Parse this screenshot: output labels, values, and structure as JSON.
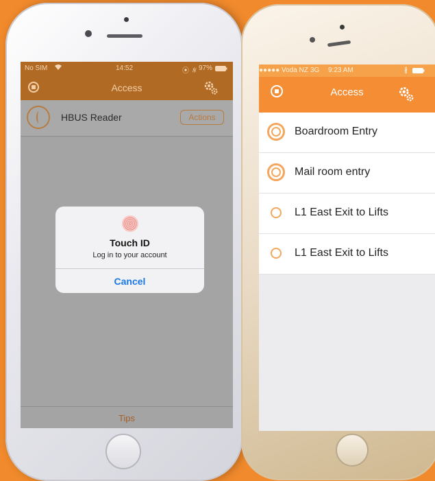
{
  "left_phone": {
    "status": {
      "carrier": "No SIM",
      "time": "14:52",
      "battery": "97%"
    },
    "nav": {
      "title": "Access"
    },
    "reader": {
      "name": "HBUS Reader",
      "actions_label": "Actions"
    },
    "touch_id_dialog": {
      "title": "Touch ID",
      "message": "Log in to your account",
      "cancel_label": "Cancel"
    },
    "footer": {
      "tips_label": "Tips"
    }
  },
  "right_phone": {
    "status": {
      "carrier": "●●●●● Voda NZ",
      "network": "3G",
      "time": "9:23 AM"
    },
    "nav": {
      "title": "Access"
    },
    "doors": [
      {
        "label": "Boardroom Entry"
      },
      {
        "label": "Mail room entry"
      },
      {
        "label": "L1 East Exit to Lifts"
      },
      {
        "label": "L1 East Exit to Lifts"
      }
    ]
  },
  "colors": {
    "background": "#f18a2c",
    "accent_orange": "#f48d34",
    "dimmed_orange": "#b06a24",
    "link_blue": "#1a78e6"
  },
  "icons": [
    "stop-icon",
    "gear-icon",
    "reader-logo-icon",
    "fingerprint-icon",
    "wifi-icon",
    "bluetooth-icon",
    "battery-icon",
    "door-ring-icon"
  ]
}
